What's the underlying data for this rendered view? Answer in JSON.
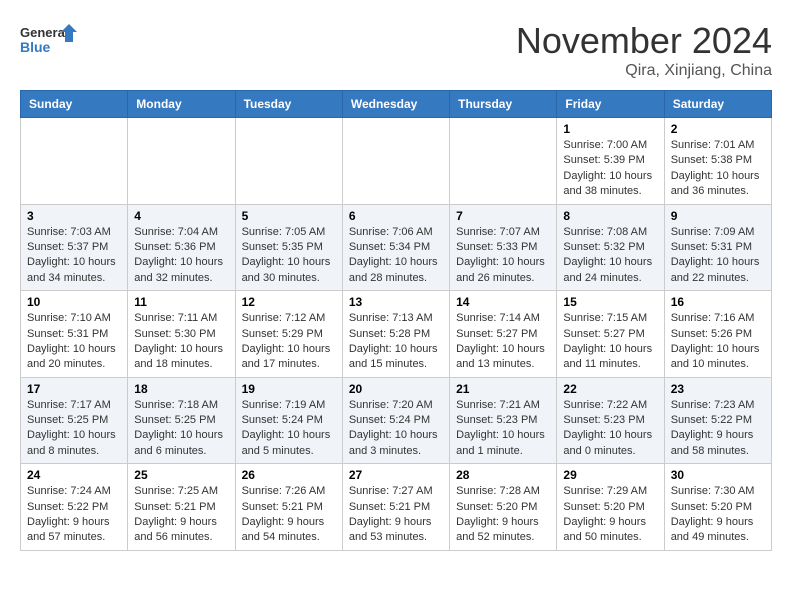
{
  "logo": {
    "line1": "General",
    "line2": "Blue"
  },
  "title": "November 2024",
  "location": "Qira, Xinjiang, China",
  "weekdays": [
    "Sunday",
    "Monday",
    "Tuesday",
    "Wednesday",
    "Thursday",
    "Friday",
    "Saturday"
  ],
  "weeks": [
    [
      {
        "day": "",
        "info": ""
      },
      {
        "day": "",
        "info": ""
      },
      {
        "day": "",
        "info": ""
      },
      {
        "day": "",
        "info": ""
      },
      {
        "day": "",
        "info": ""
      },
      {
        "day": "1",
        "info": "Sunrise: 7:00 AM\nSunset: 5:39 PM\nDaylight: 10 hours and 38 minutes."
      },
      {
        "day": "2",
        "info": "Sunrise: 7:01 AM\nSunset: 5:38 PM\nDaylight: 10 hours and 36 minutes."
      }
    ],
    [
      {
        "day": "3",
        "info": "Sunrise: 7:03 AM\nSunset: 5:37 PM\nDaylight: 10 hours and 34 minutes."
      },
      {
        "day": "4",
        "info": "Sunrise: 7:04 AM\nSunset: 5:36 PM\nDaylight: 10 hours and 32 minutes."
      },
      {
        "day": "5",
        "info": "Sunrise: 7:05 AM\nSunset: 5:35 PM\nDaylight: 10 hours and 30 minutes."
      },
      {
        "day": "6",
        "info": "Sunrise: 7:06 AM\nSunset: 5:34 PM\nDaylight: 10 hours and 28 minutes."
      },
      {
        "day": "7",
        "info": "Sunrise: 7:07 AM\nSunset: 5:33 PM\nDaylight: 10 hours and 26 minutes."
      },
      {
        "day": "8",
        "info": "Sunrise: 7:08 AM\nSunset: 5:32 PM\nDaylight: 10 hours and 24 minutes."
      },
      {
        "day": "9",
        "info": "Sunrise: 7:09 AM\nSunset: 5:31 PM\nDaylight: 10 hours and 22 minutes."
      }
    ],
    [
      {
        "day": "10",
        "info": "Sunrise: 7:10 AM\nSunset: 5:31 PM\nDaylight: 10 hours and 20 minutes."
      },
      {
        "day": "11",
        "info": "Sunrise: 7:11 AM\nSunset: 5:30 PM\nDaylight: 10 hours and 18 minutes."
      },
      {
        "day": "12",
        "info": "Sunrise: 7:12 AM\nSunset: 5:29 PM\nDaylight: 10 hours and 17 minutes."
      },
      {
        "day": "13",
        "info": "Sunrise: 7:13 AM\nSunset: 5:28 PM\nDaylight: 10 hours and 15 minutes."
      },
      {
        "day": "14",
        "info": "Sunrise: 7:14 AM\nSunset: 5:27 PM\nDaylight: 10 hours and 13 minutes."
      },
      {
        "day": "15",
        "info": "Sunrise: 7:15 AM\nSunset: 5:27 PM\nDaylight: 10 hours and 11 minutes."
      },
      {
        "day": "16",
        "info": "Sunrise: 7:16 AM\nSunset: 5:26 PM\nDaylight: 10 hours and 10 minutes."
      }
    ],
    [
      {
        "day": "17",
        "info": "Sunrise: 7:17 AM\nSunset: 5:25 PM\nDaylight: 10 hours and 8 minutes."
      },
      {
        "day": "18",
        "info": "Sunrise: 7:18 AM\nSunset: 5:25 PM\nDaylight: 10 hours and 6 minutes."
      },
      {
        "day": "19",
        "info": "Sunrise: 7:19 AM\nSunset: 5:24 PM\nDaylight: 10 hours and 5 minutes."
      },
      {
        "day": "20",
        "info": "Sunrise: 7:20 AM\nSunset: 5:24 PM\nDaylight: 10 hours and 3 minutes."
      },
      {
        "day": "21",
        "info": "Sunrise: 7:21 AM\nSunset: 5:23 PM\nDaylight: 10 hours and 1 minute."
      },
      {
        "day": "22",
        "info": "Sunrise: 7:22 AM\nSunset: 5:23 PM\nDaylight: 10 hours and 0 minutes."
      },
      {
        "day": "23",
        "info": "Sunrise: 7:23 AM\nSunset: 5:22 PM\nDaylight: 9 hours and 58 minutes."
      }
    ],
    [
      {
        "day": "24",
        "info": "Sunrise: 7:24 AM\nSunset: 5:22 PM\nDaylight: 9 hours and 57 minutes."
      },
      {
        "day": "25",
        "info": "Sunrise: 7:25 AM\nSunset: 5:21 PM\nDaylight: 9 hours and 56 minutes."
      },
      {
        "day": "26",
        "info": "Sunrise: 7:26 AM\nSunset: 5:21 PM\nDaylight: 9 hours and 54 minutes."
      },
      {
        "day": "27",
        "info": "Sunrise: 7:27 AM\nSunset: 5:21 PM\nDaylight: 9 hours and 53 minutes."
      },
      {
        "day": "28",
        "info": "Sunrise: 7:28 AM\nSunset: 5:20 PM\nDaylight: 9 hours and 52 minutes."
      },
      {
        "day": "29",
        "info": "Sunrise: 7:29 AM\nSunset: 5:20 PM\nDaylight: 9 hours and 50 minutes."
      },
      {
        "day": "30",
        "info": "Sunrise: 7:30 AM\nSunset: 5:20 PM\nDaylight: 9 hours and 49 minutes."
      }
    ]
  ]
}
